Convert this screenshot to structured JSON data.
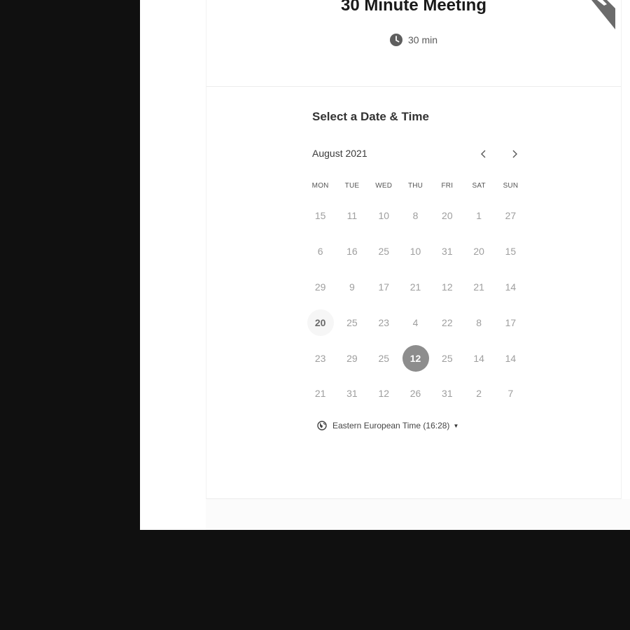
{
  "event": {
    "title": "30 Minute Meeting",
    "duration": "30 min"
  },
  "calendar": {
    "heading": "Select a Date & Time",
    "month": "August 2021",
    "prev_icon": "chevron-left-icon",
    "next_icon": "chevron-right-icon",
    "weekdays": [
      "MON",
      "TUE",
      "WED",
      "THU",
      "FRI",
      "SAT",
      "SUN"
    ],
    "weeks": [
      [
        "15",
        "11",
        "10",
        "8",
        "20",
        "1",
        "27"
      ],
      [
        "6",
        "16",
        "25",
        "10",
        "31",
        "20",
        "15"
      ],
      [
        "29",
        "9",
        "17",
        "21",
        "12",
        "21",
        "14"
      ],
      [
        "20",
        "25",
        "23",
        "4",
        "22",
        "8",
        "17"
      ],
      [
        "23",
        "29",
        "25",
        "12",
        "25",
        "14",
        "14"
      ],
      [
        "21",
        "31",
        "12",
        "26",
        "31",
        "2",
        "7"
      ]
    ],
    "today": {
      "week": 3,
      "day": 0
    },
    "selected": {
      "week": 4,
      "day": 3
    }
  },
  "timezone": {
    "label": "Eastern European Time (16:28)",
    "icon": "globe-icon"
  },
  "colors": {
    "background": "#101010",
    "selected_day": "#8d8d8d",
    "ribbon": "#6b6b6b"
  }
}
